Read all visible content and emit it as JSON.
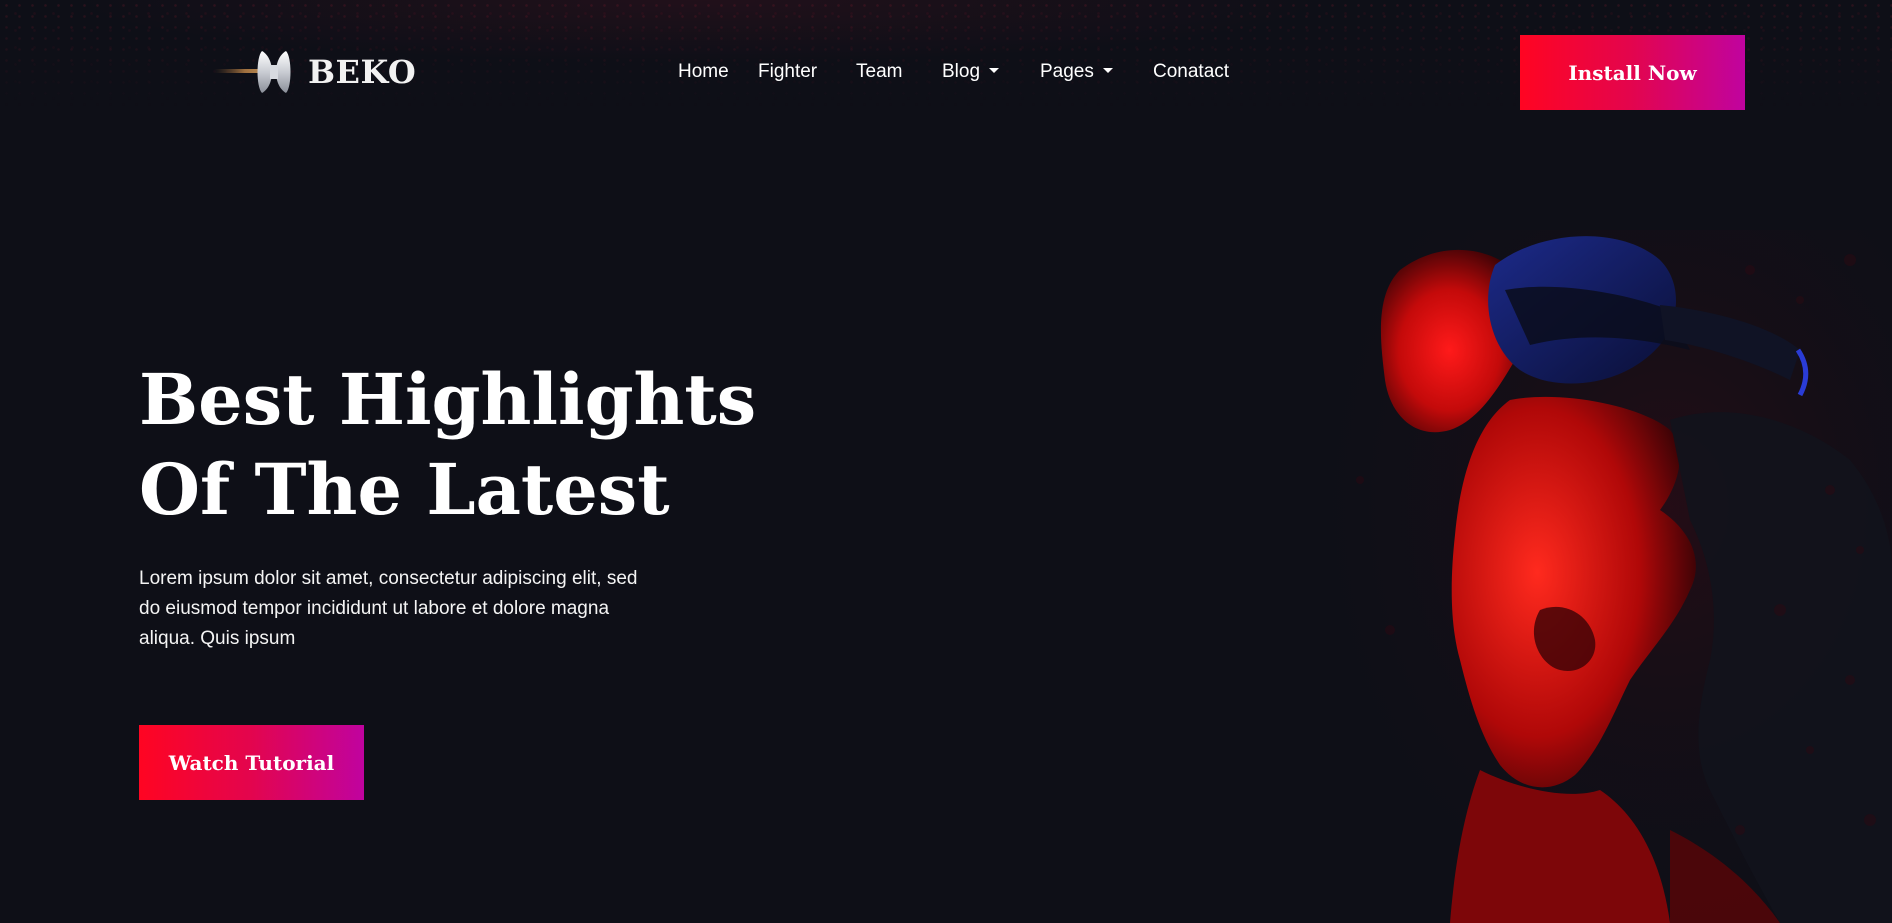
{
  "brand": {
    "name": "BEKO",
    "logo_icon": "axe-logo-icon"
  },
  "nav": {
    "items": [
      {
        "label": "Home",
        "dropdown": false
      },
      {
        "label": "Fighter",
        "dropdown": false
      },
      {
        "label": "Team",
        "dropdown": false
      },
      {
        "label": "Blog",
        "dropdown": true
      },
      {
        "label": "Pages",
        "dropdown": true
      },
      {
        "label": "Conatact",
        "dropdown": false
      }
    ]
  },
  "header": {
    "cta_label": "Install Now"
  },
  "hero": {
    "title_line1": "Best Highlights",
    "title_line2": "Of The Latest",
    "description": "Lorem ipsum dolor sit amet, consectetur adipiscing elit, sed do eiusmod tempor incididunt ut labore et dolore magna aliqua. Quis ipsum",
    "cta_label": "Watch Tutorial",
    "image_icon": "vr-headset-gamer-illustration"
  },
  "colors": {
    "background": "#0e0f17",
    "gradient_start": "#ff0522",
    "gradient_end": "#c0039f",
    "text": "#ffffff"
  }
}
